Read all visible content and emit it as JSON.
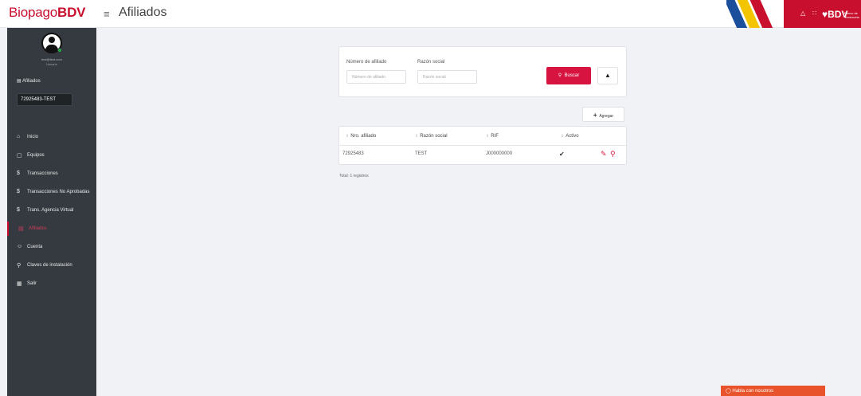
{
  "header": {
    "brand_prefix": "Biopago",
    "brand_suffix": "BDV",
    "menu_icon": "≡",
    "page_title": "Afiliados",
    "bank_logo": "BDV",
    "bank_subtitle": "Banco de Venezuela",
    "stripe_colors": [
      "#1b4f9c",
      "#f2c500",
      "#c8102e"
    ]
  },
  "sidebar": {
    "user_email": "test@test.com",
    "user_role": "Usuario",
    "affiliates_heading": "Afiliados",
    "selected_affiliate": "72925483-TEST",
    "items": [
      {
        "label": "Inicio",
        "icon": "home-icon"
      },
      {
        "label": "Equipos",
        "icon": "device-icon"
      },
      {
        "label": "Transacciones",
        "icon": "dollar-icon"
      },
      {
        "label": "Transacciones No Aprobadas",
        "icon": "dollar-icon"
      },
      {
        "label": "Trans. Agencia Virtual",
        "icon": "dollar-icon"
      },
      {
        "label": "Afiliados",
        "icon": "store-icon",
        "active": true
      },
      {
        "label": "Cuenta",
        "icon": "user-icon"
      },
      {
        "label": "Claves de instalación",
        "icon": "key-icon"
      },
      {
        "label": "Salir",
        "icon": "exit-icon"
      }
    ]
  },
  "filters": {
    "affiliate_number_label": "Número de afiliado",
    "affiliate_number_placeholder": "Número de afiliado",
    "company_label": "Razón social",
    "company_placeholder": "Razón social",
    "search_label": "Buscar",
    "add_label": "Agregar"
  },
  "table": {
    "headers": [
      "Nro. afiliado",
      "Razón social",
      "RIF",
      "Activo"
    ],
    "rows": [
      {
        "number": "72925483",
        "company": "TEST",
        "rif": "J000000000",
        "active": "✔"
      }
    ],
    "total": "Total: 1 registros"
  },
  "chat": {
    "label": "Habla con nosotros"
  },
  "colors": {
    "brand_red": "#c8102e",
    "sidebar_bg": "#343a40",
    "chat_orange": "#e8532b"
  }
}
